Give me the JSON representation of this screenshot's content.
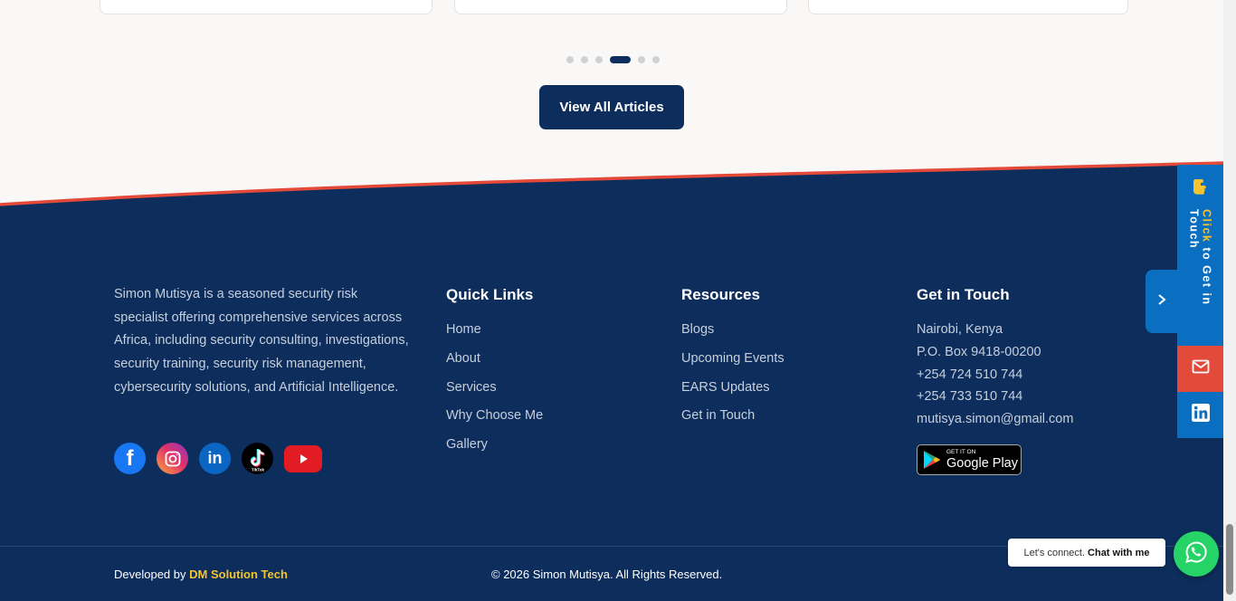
{
  "articles": {
    "view_all_label": "View All Articles",
    "carousel_total": 6,
    "carousel_active": 4
  },
  "footer": {
    "about": "Simon Mutisya is a seasoned security risk specialist offering comprehensive services across Africa, including security consulting, investigations, security training, security risk management, cybersecurity solutions, and Artificial Intelligence.",
    "socials": [
      "facebook-icon",
      "instagram-icon",
      "linkedin-icon",
      "tiktok-icon",
      "youtube-icon"
    ],
    "tiktok_label": "TikTok",
    "quick_links": {
      "title": "Quick Links",
      "items": [
        "Home",
        "About",
        "Services",
        "Why Choose Me",
        "Gallery"
      ]
    },
    "resources": {
      "title": "Resources",
      "items": [
        "Blogs",
        "Upcoming Events",
        "EARS Updates",
        "Get in Touch"
      ]
    },
    "contact": {
      "title": "Get in Touch",
      "location": "Nairobi, Kenya",
      "po_box": "P.O. Box 9418-00200",
      "phone1": "+254 724 510 744",
      "phone2": "+254 733 510 744",
      "email": "mutisya.simon@gmail.com",
      "store_small": "GET IT ON",
      "store_big": "Google Play"
    },
    "developed_by": "Developed by",
    "developer": "DM Solution Tech",
    "copyright": "© 2026 Simon Mutisya. All Rights Reserved."
  },
  "side_panel": {
    "cta_highlight": "Click",
    "cta_rest": " to Get in Touch"
  },
  "chat": {
    "prompt": "Let's connect.",
    "action": "Chat with me"
  },
  "colors": {
    "navy": "#0d2d5c",
    "accent_red": "#e34a3a",
    "brand_blue": "#0a6fc1",
    "highlight_yellow": "#f4c430",
    "whatsapp_green": "#25d366"
  }
}
